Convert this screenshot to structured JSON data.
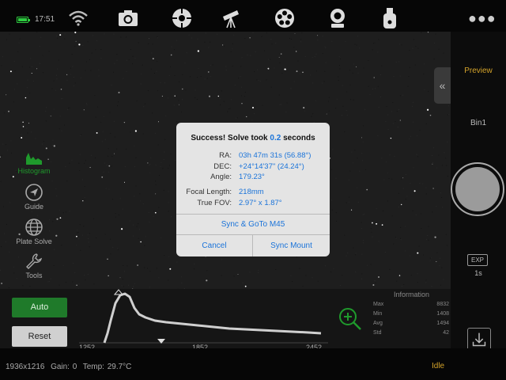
{
  "status": {
    "time": "17:51"
  },
  "topbar": {
    "icons": [
      "wifi-icon",
      "camera-icon",
      "focuser-icon",
      "telescope-icon",
      "filter-wheel-icon",
      "webcam-icon",
      "usb-drive-icon",
      "more-icon"
    ]
  },
  "tools": [
    {
      "label": "Histogram",
      "icon": "histogram-icon",
      "active": true
    },
    {
      "label": "Guide",
      "icon": "guide-icon",
      "active": false
    },
    {
      "label": "Plate Solve",
      "icon": "globe-icon",
      "active": false
    },
    {
      "label": "Tools",
      "icon": "wrench-icon",
      "active": false
    }
  ],
  "right_panel": {
    "preview_label": "Preview",
    "bin_label": "Bin1",
    "exp_label": "EXP",
    "exp_value": "1s"
  },
  "histogram": {
    "auto_label": "Auto",
    "reset_label": "Reset",
    "ticks": [
      "1252",
      "1852",
      "2452"
    ],
    "info_title": "Information",
    "stats": [
      {
        "label": "Max",
        "value": "8832"
      },
      {
        "label": "Min",
        "value": "1408"
      },
      {
        "label": "Avg",
        "value": "1494"
      },
      {
        "label": "Std",
        "value": "42"
      }
    ]
  },
  "statusbar": {
    "resolution": "1936x1216",
    "gain": "Gain: 0",
    "temp": "Temp: 29.7°C",
    "state": "Idle"
  },
  "dialog": {
    "title_prefix": "Success!  Solve took ",
    "title_value": "0.2",
    "title_suffix": " seconds",
    "rows": [
      {
        "label": "RA:",
        "value": "03h 47m 31s (56.88°)"
      },
      {
        "label": "DEC:",
        "value": "+24°14'37\" (24.24°)"
      },
      {
        "label": "Angle:",
        "value": "179.23°"
      },
      {
        "label": "Focal Length:",
        "value": "218mm"
      },
      {
        "label": "True FOV:",
        "value": "2.97° x 1.87°"
      }
    ],
    "sync_goto_label": "Sync & GoTo M45",
    "cancel_label": "Cancel",
    "sync_mount_label": "Sync Mount"
  },
  "colors": {
    "accent_blue": "#1a73d9",
    "active_green": "#2ecc40",
    "status_orange": "#d4a32a"
  }
}
